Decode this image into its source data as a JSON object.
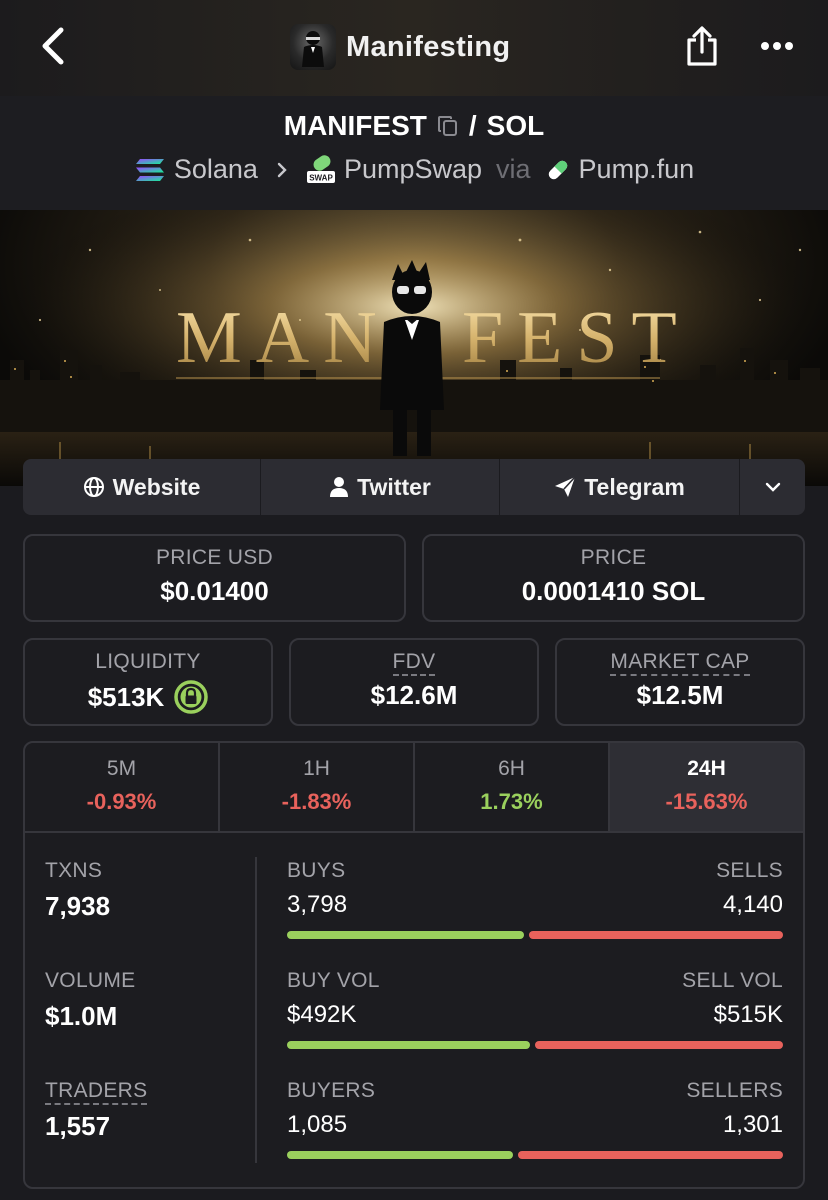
{
  "header": {
    "title": "Manifesting",
    "back_icon": "chevron-left-icon",
    "share_icon": "share-icon",
    "more_icon": "more-dots-icon"
  },
  "pair": {
    "base": "MANIFEST",
    "separator": "/",
    "quote": "SOL",
    "chain": "Solana",
    "dex": "PumpSwap",
    "via_label": "via",
    "launchpad": "Pump.fun",
    "dex_badge": "SWAP"
  },
  "banner": {
    "text_left": "MAN",
    "text_right": "FEST"
  },
  "links": [
    {
      "label": "Website",
      "icon": "globe-icon"
    },
    {
      "label": "Twitter",
      "icon": "user-icon"
    },
    {
      "label": "Telegram",
      "icon": "paper-plane-icon"
    }
  ],
  "prices": {
    "usd_label": "PRICE USD",
    "usd_value": "$0.01400",
    "native_label": "PRICE",
    "native_value": "0.0001410 SOL"
  },
  "metrics": {
    "liquidity_label": "LIQUIDITY",
    "liquidity_value": "$513K",
    "fdv_label": "FDV",
    "fdv_value": "$12.6M",
    "mcap_label": "MARKET CAP",
    "mcap_value": "$12.5M"
  },
  "timeframes": [
    {
      "label": "5M",
      "change": "-0.93%",
      "direction": "down"
    },
    {
      "label": "1H",
      "change": "-1.83%",
      "direction": "down"
    },
    {
      "label": "6H",
      "change": "1.73%",
      "direction": "up"
    },
    {
      "label": "24H",
      "change": "-15.63%",
      "direction": "down",
      "active": true
    }
  ],
  "stats": {
    "txns_label": "TXNS",
    "txns_value": "7,938",
    "volume_label": "VOLUME",
    "volume_value": "$1.0M",
    "traders_label": "TRADERS",
    "traders_value": "1,557"
  },
  "bars": [
    {
      "left_label": "BUYS",
      "right_label": "SELLS",
      "left_value": "3,798",
      "right_value": "4,140",
      "buy_fraction": 0.478
    },
    {
      "left_label": "BUY VOL",
      "right_label": "SELL VOL",
      "left_value": "$492K",
      "right_value": "$515K",
      "buy_fraction": 0.489
    },
    {
      "left_label": "BUYERS",
      "right_label": "SELLERS",
      "left_value": "1,085",
      "right_value": "1,301",
      "buy_fraction": 0.455
    }
  ],
  "colors": {
    "buy": "#9ad05d",
    "sell": "#e8625c",
    "background": "#1b1b1f",
    "border": "#36363c"
  }
}
